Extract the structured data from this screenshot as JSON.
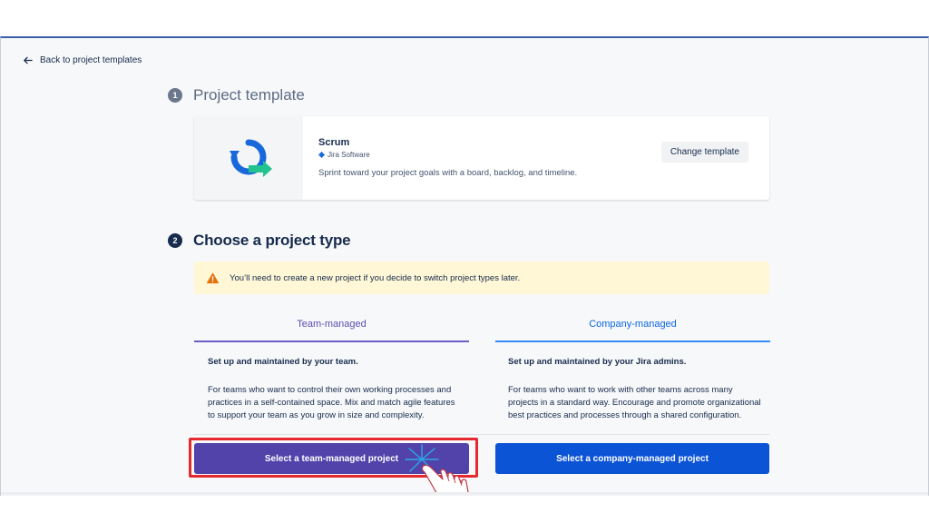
{
  "nav": {
    "back_label": "Back to project templates"
  },
  "step1": {
    "number": "1",
    "title": "Project template"
  },
  "template": {
    "name": "Scrum",
    "product": "Jira Software",
    "description": "Sprint toward your project goals with a board, backlog, and timeline.",
    "change_label": "Change template",
    "icon": "scrum-cycle-icon"
  },
  "step2": {
    "number": "2",
    "title": "Choose a project type"
  },
  "warning": {
    "icon": "warning-triangle-icon",
    "text": "You’ll need to create a new project if you decide to switch project types later."
  },
  "team_managed": {
    "tab_label": "Team-managed",
    "heading": "Set up and maintained by your team.",
    "description": "For teams who want to control their own working processes and practices in a self-contained space. Mix and match agile features to support your team as you grow in size and complexity.",
    "button_label": "Select a team-managed project"
  },
  "company_managed": {
    "tab_label": "Company-managed",
    "heading": "Set up and maintained by your Jira admins.",
    "description": "For teams who want to work with other teams across many projects in a standard way. Encourage and promote organizational best practices and processes through a shared configuration.",
    "button_label": "Select a company-managed project"
  },
  "colors": {
    "team_accent": "#5243aa",
    "company_accent": "#0c54d6",
    "highlight": "#e5292f",
    "warning_bg": "#fff7d6"
  }
}
